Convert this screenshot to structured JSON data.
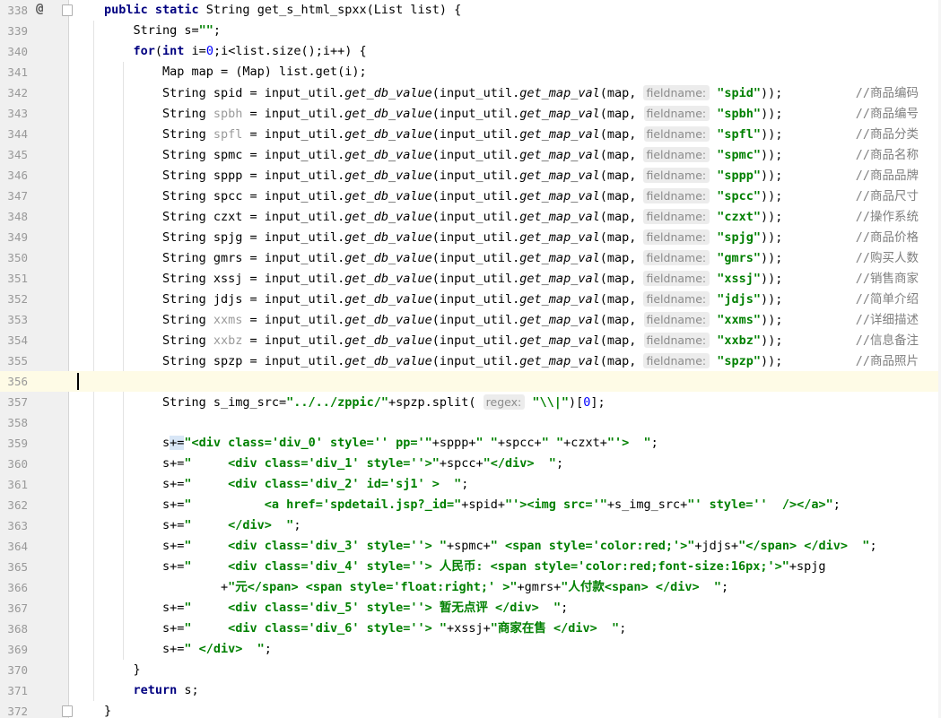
{
  "editor": {
    "current_line": 356,
    "gutter_marker": "@",
    "lines": [
      {
        "n": 338,
        "marker": "@",
        "fold": true,
        "indent": 0,
        "segs": [
          {
            "t": "public static ",
            "c": "kw"
          },
          {
            "t": "String get_s_html_spxx(List list) {"
          }
        ]
      },
      {
        "n": 339,
        "indent": 1,
        "segs": [
          {
            "t": "String s="
          },
          {
            "t": "\"\"",
            "c": "str"
          },
          {
            "t": ";"
          }
        ]
      },
      {
        "n": 340,
        "indent": 1,
        "segs": [
          {
            "t": "for",
            "c": "kw"
          },
          {
            "t": "("
          },
          {
            "t": "int ",
            "c": "kw"
          },
          {
            "t": "i="
          },
          {
            "t": "0",
            "c": "num"
          },
          {
            "t": ";i<list.size();i++) {"
          }
        ]
      },
      {
        "n": 341,
        "indent": 2,
        "segs": [
          {
            "t": "Map map = (Map) list.get(i);"
          }
        ]
      },
      {
        "n": 342,
        "indent": 2,
        "segs": [
          {
            "t": "String spid = input_util."
          },
          {
            "t": "get_db_value",
            "c": "ital"
          },
          {
            "t": "(input_util."
          },
          {
            "t": "get_map_val",
            "c": "ital"
          },
          {
            "t": "(map, "
          },
          {
            "t": "fieldname:",
            "c": "hint"
          },
          {
            "t": " "
          },
          {
            "t": "\"spid\"",
            "c": "str"
          },
          {
            "t": "));"
          },
          {
            "t": "          //商品编码",
            "c": "cmt"
          }
        ]
      },
      {
        "n": 343,
        "indent": 2,
        "segs": [
          {
            "t": "String "
          },
          {
            "t": "spbh",
            "c": "gray"
          },
          {
            "t": " = input_util."
          },
          {
            "t": "get_db_value",
            "c": "ital"
          },
          {
            "t": "(input_util."
          },
          {
            "t": "get_map_val",
            "c": "ital"
          },
          {
            "t": "(map, "
          },
          {
            "t": "fieldname:",
            "c": "hint"
          },
          {
            "t": " "
          },
          {
            "t": "\"spbh\"",
            "c": "str"
          },
          {
            "t": "));"
          },
          {
            "t": "          //商品编号",
            "c": "cmt"
          }
        ]
      },
      {
        "n": 344,
        "indent": 2,
        "segs": [
          {
            "t": "String "
          },
          {
            "t": "spfl",
            "c": "gray"
          },
          {
            "t": " = input_util."
          },
          {
            "t": "get_db_value",
            "c": "ital"
          },
          {
            "t": "(input_util."
          },
          {
            "t": "get_map_val",
            "c": "ital"
          },
          {
            "t": "(map, "
          },
          {
            "t": "fieldname:",
            "c": "hint"
          },
          {
            "t": " "
          },
          {
            "t": "\"spfl\"",
            "c": "str"
          },
          {
            "t": "));"
          },
          {
            "t": "          //商品分类",
            "c": "cmt"
          }
        ]
      },
      {
        "n": 345,
        "indent": 2,
        "segs": [
          {
            "t": "String spmc = input_util."
          },
          {
            "t": "get_db_value",
            "c": "ital"
          },
          {
            "t": "(input_util."
          },
          {
            "t": "get_map_val",
            "c": "ital"
          },
          {
            "t": "(map, "
          },
          {
            "t": "fieldname:",
            "c": "hint"
          },
          {
            "t": " "
          },
          {
            "t": "\"spmc\"",
            "c": "str"
          },
          {
            "t": "));"
          },
          {
            "t": "          //商品名称",
            "c": "cmt"
          }
        ]
      },
      {
        "n": 346,
        "indent": 2,
        "segs": [
          {
            "t": "String sppp = input_util."
          },
          {
            "t": "get_db_value",
            "c": "ital"
          },
          {
            "t": "(input_util."
          },
          {
            "t": "get_map_val",
            "c": "ital"
          },
          {
            "t": "(map, "
          },
          {
            "t": "fieldname:",
            "c": "hint"
          },
          {
            "t": " "
          },
          {
            "t": "\"sppp\"",
            "c": "str"
          },
          {
            "t": "));"
          },
          {
            "t": "          //商品品牌",
            "c": "cmt"
          }
        ]
      },
      {
        "n": 347,
        "indent": 2,
        "segs": [
          {
            "t": "String spcc = input_util."
          },
          {
            "t": "get_db_value",
            "c": "ital"
          },
          {
            "t": "(input_util."
          },
          {
            "t": "get_map_val",
            "c": "ital"
          },
          {
            "t": "(map, "
          },
          {
            "t": "fieldname:",
            "c": "hint"
          },
          {
            "t": " "
          },
          {
            "t": "\"spcc\"",
            "c": "str"
          },
          {
            "t": "));"
          },
          {
            "t": "          //商品尺寸",
            "c": "cmt"
          }
        ]
      },
      {
        "n": 348,
        "indent": 2,
        "segs": [
          {
            "t": "String czxt = input_util."
          },
          {
            "t": "get_db_value",
            "c": "ital"
          },
          {
            "t": "(input_util."
          },
          {
            "t": "get_map_val",
            "c": "ital"
          },
          {
            "t": "(map, "
          },
          {
            "t": "fieldname:",
            "c": "hint"
          },
          {
            "t": " "
          },
          {
            "t": "\"czxt\"",
            "c": "str"
          },
          {
            "t": "));"
          },
          {
            "t": "          //操作系统",
            "c": "cmt"
          }
        ]
      },
      {
        "n": 349,
        "indent": 2,
        "segs": [
          {
            "t": "String spjg = input_util."
          },
          {
            "t": "get_db_value",
            "c": "ital"
          },
          {
            "t": "(input_util."
          },
          {
            "t": "get_map_val",
            "c": "ital"
          },
          {
            "t": "(map, "
          },
          {
            "t": "fieldname:",
            "c": "hint"
          },
          {
            "t": " "
          },
          {
            "t": "\"spjg\"",
            "c": "str"
          },
          {
            "t": "));"
          },
          {
            "t": "          //商品价格",
            "c": "cmt"
          }
        ]
      },
      {
        "n": 350,
        "indent": 2,
        "segs": [
          {
            "t": "String gmrs = input_util."
          },
          {
            "t": "get_db_value",
            "c": "ital"
          },
          {
            "t": "(input_util."
          },
          {
            "t": "get_map_val",
            "c": "ital"
          },
          {
            "t": "(map, "
          },
          {
            "t": "fieldname:",
            "c": "hint"
          },
          {
            "t": " "
          },
          {
            "t": "\"gmrs\"",
            "c": "str"
          },
          {
            "t": "));"
          },
          {
            "t": "          //购买人数",
            "c": "cmt"
          }
        ]
      },
      {
        "n": 351,
        "indent": 2,
        "segs": [
          {
            "t": "String xssj = input_util."
          },
          {
            "t": "get_db_value",
            "c": "ital"
          },
          {
            "t": "(input_util."
          },
          {
            "t": "get_map_val",
            "c": "ital"
          },
          {
            "t": "(map, "
          },
          {
            "t": "fieldname:",
            "c": "hint"
          },
          {
            "t": " "
          },
          {
            "t": "\"xssj\"",
            "c": "str"
          },
          {
            "t": "));"
          },
          {
            "t": "          //销售商家",
            "c": "cmt"
          }
        ]
      },
      {
        "n": 352,
        "indent": 2,
        "segs": [
          {
            "t": "String jdjs = input_util."
          },
          {
            "t": "get_db_value",
            "c": "ital"
          },
          {
            "t": "(input_util."
          },
          {
            "t": "get_map_val",
            "c": "ital"
          },
          {
            "t": "(map, "
          },
          {
            "t": "fieldname:",
            "c": "hint"
          },
          {
            "t": " "
          },
          {
            "t": "\"jdjs\"",
            "c": "str"
          },
          {
            "t": "));"
          },
          {
            "t": "          //简单介绍",
            "c": "cmt"
          }
        ]
      },
      {
        "n": 353,
        "indent": 2,
        "segs": [
          {
            "t": "String "
          },
          {
            "t": "xxms",
            "c": "gray"
          },
          {
            "t": " = input_util."
          },
          {
            "t": "get_db_value",
            "c": "ital"
          },
          {
            "t": "(input_util."
          },
          {
            "t": "get_map_val",
            "c": "ital"
          },
          {
            "t": "(map, "
          },
          {
            "t": "fieldname:",
            "c": "hint"
          },
          {
            "t": " "
          },
          {
            "t": "\"xxms\"",
            "c": "str"
          },
          {
            "t": "));"
          },
          {
            "t": "          //详细描述",
            "c": "cmt"
          }
        ]
      },
      {
        "n": 354,
        "indent": 2,
        "segs": [
          {
            "t": "String "
          },
          {
            "t": "xxbz",
            "c": "gray"
          },
          {
            "t": " = input_util."
          },
          {
            "t": "get_db_value",
            "c": "ital"
          },
          {
            "t": "(input_util."
          },
          {
            "t": "get_map_val",
            "c": "ital"
          },
          {
            "t": "(map, "
          },
          {
            "t": "fieldname:",
            "c": "hint"
          },
          {
            "t": " "
          },
          {
            "t": "\"xxbz\"",
            "c": "str"
          },
          {
            "t": "));"
          },
          {
            "t": "          //信息备注",
            "c": "cmt"
          }
        ]
      },
      {
        "n": 355,
        "indent": 2,
        "segs": [
          {
            "t": "String spzp = input_util."
          },
          {
            "t": "get_db_value",
            "c": "ital"
          },
          {
            "t": "(input_util."
          },
          {
            "t": "get_map_val",
            "c": "ital"
          },
          {
            "t": "(map, "
          },
          {
            "t": "fieldname:",
            "c": "hint"
          },
          {
            "t": " "
          },
          {
            "t": "\"spzp\"",
            "c": "str"
          },
          {
            "t": "));"
          },
          {
            "t": "          //商品照片",
            "c": "cmt"
          }
        ]
      },
      {
        "n": 356,
        "indent": 0,
        "caret": true,
        "segs": []
      },
      {
        "n": 357,
        "indent": 2,
        "segs": [
          {
            "t": "String s_img_src="
          },
          {
            "t": "\"../../zppic/\"",
            "c": "str"
          },
          {
            "t": "+spzp.split( "
          },
          {
            "t": "regex:",
            "c": "hint"
          },
          {
            "t": " "
          },
          {
            "t": "\"\\\\|\"",
            "c": "str"
          },
          {
            "t": ")["
          },
          {
            "t": "0",
            "c": "num"
          },
          {
            "t": "];"
          }
        ]
      },
      {
        "n": 358,
        "indent": 2,
        "segs": []
      },
      {
        "n": 359,
        "indent": 2,
        "segs": [
          {
            "t": "s"
          },
          {
            "t": "+=",
            "c": "brace-hl"
          },
          {
            "t": "\"<div class='div_0' style='' pp='\"",
            "c": "str"
          },
          {
            "t": "+sppp+"
          },
          {
            "t": "\" \"",
            "c": "str"
          },
          {
            "t": "+spcc+"
          },
          {
            "t": "\" \"",
            "c": "str"
          },
          {
            "t": "+czxt+"
          },
          {
            "t": "\"'>  \"",
            "c": "str"
          },
          {
            "t": ";"
          }
        ]
      },
      {
        "n": 360,
        "indent": 2,
        "segs": [
          {
            "t": "s+="
          },
          {
            "t": "\"     <div class='div_1' style=''>\"",
            "c": "str"
          },
          {
            "t": "+spcc+"
          },
          {
            "t": "\"</div>  \"",
            "c": "str"
          },
          {
            "t": ";"
          }
        ]
      },
      {
        "n": 361,
        "indent": 2,
        "segs": [
          {
            "t": "s+="
          },
          {
            "t": "\"     <div class='div_2' id='sj1' >  \"",
            "c": "str"
          },
          {
            "t": ";"
          }
        ]
      },
      {
        "n": 362,
        "indent": 2,
        "segs": [
          {
            "t": "s+="
          },
          {
            "t": "\"          <a href='spdetail.jsp?_id=\"",
            "c": "str"
          },
          {
            "t": "+spid+"
          },
          {
            "t": "\"'><img src='\"",
            "c": "str"
          },
          {
            "t": "+s_img_src+"
          },
          {
            "t": "\"' style=''  /></a>\"",
            "c": "str"
          },
          {
            "t": ";"
          }
        ]
      },
      {
        "n": 363,
        "indent": 2,
        "segs": [
          {
            "t": "s+="
          },
          {
            "t": "\"     </div>  \"",
            "c": "str"
          },
          {
            "t": ";"
          }
        ]
      },
      {
        "n": 364,
        "indent": 2,
        "segs": [
          {
            "t": "s+="
          },
          {
            "t": "\"     <div class='div_3' style=''> \"",
            "c": "str"
          },
          {
            "t": "+spmc+"
          },
          {
            "t": "\" <span style='color:red;'>\"",
            "c": "str"
          },
          {
            "t": "+jdjs+"
          },
          {
            "t": "\"</span> </div>  \"",
            "c": "str"
          },
          {
            "t": ";"
          }
        ]
      },
      {
        "n": 365,
        "indent": 2,
        "segs": [
          {
            "t": "s+="
          },
          {
            "t": "\"     <div class='div_4' style=''> 人民币: <span style='color:red;font-size:16px;'>\"",
            "c": "str"
          },
          {
            "t": "+spjg"
          }
        ]
      },
      {
        "n": 366,
        "indent": 2,
        "wrap": true,
        "segs": [
          {
            "t": "        +"
          },
          {
            "t": "\"元</span> <span style='float:right;' >\"",
            "c": "str"
          },
          {
            "t": "+gmrs+"
          },
          {
            "t": "\"人付款<span> </div>  \"",
            "c": "str"
          },
          {
            "t": ";"
          }
        ]
      },
      {
        "n": 367,
        "indent": 2,
        "segs": [
          {
            "t": "s+="
          },
          {
            "t": "\"     <div class='div_5' style=''> 暂无点评 </div>  \"",
            "c": "str"
          },
          {
            "t": ";"
          }
        ]
      },
      {
        "n": 368,
        "indent": 2,
        "segs": [
          {
            "t": "s+="
          },
          {
            "t": "\"     <div class='div_6' style=''> \"",
            "c": "str"
          },
          {
            "t": "+xssj+"
          },
          {
            "t": "\"商家在售 </div>  \"",
            "c": "str"
          },
          {
            "t": ";"
          }
        ]
      },
      {
        "n": 369,
        "indent": 2,
        "segs": [
          {
            "t": "s+="
          },
          {
            "t": "\" </div>  \"",
            "c": "str"
          },
          {
            "t": ";"
          }
        ]
      },
      {
        "n": 370,
        "indent": 1,
        "segs": [
          {
            "t": "}"
          }
        ]
      },
      {
        "n": 371,
        "indent": 1,
        "segs": [
          {
            "t": "return ",
            "c": "kw"
          },
          {
            "t": "s;"
          }
        ]
      },
      {
        "n": 372,
        "fold": true,
        "indent": 0,
        "segs": [
          {
            "t": "}"
          }
        ]
      }
    ]
  }
}
